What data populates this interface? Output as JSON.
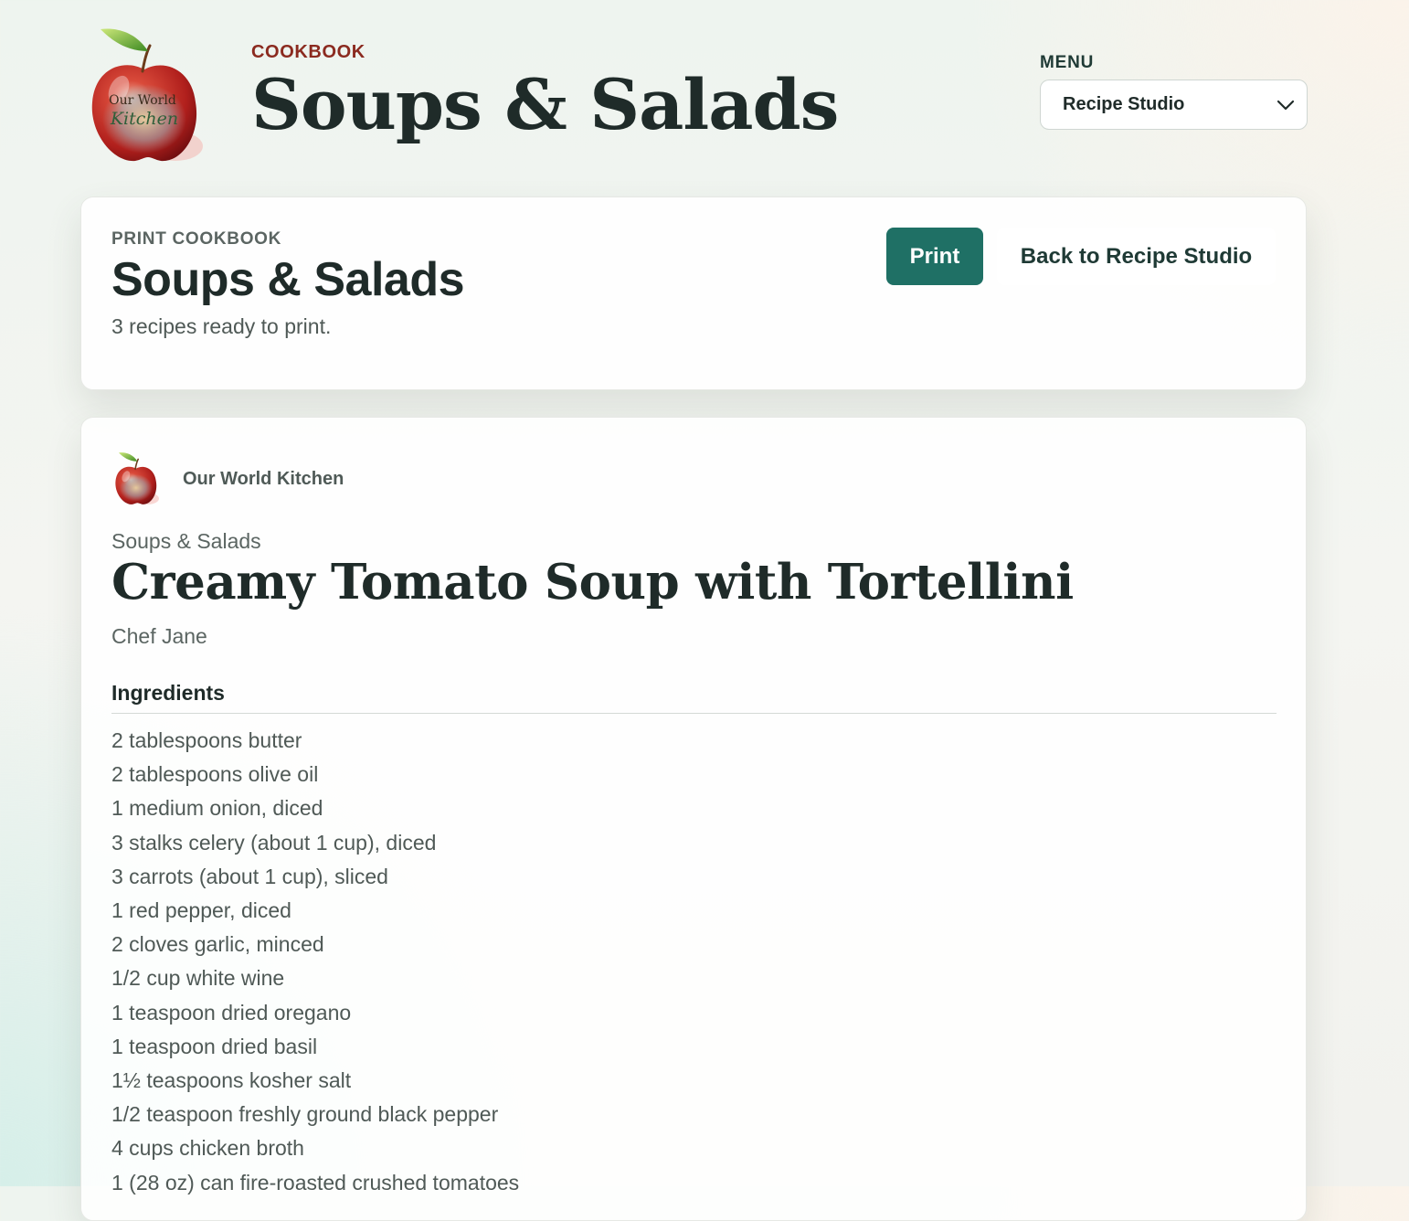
{
  "header": {
    "eyebrow": "COOKBOOK",
    "title": "Soups & Salads",
    "logo_text": [
      "Our World",
      "Kitchen"
    ],
    "logo_icon": "apple-logo-icon"
  },
  "menu": {
    "label": "MENU",
    "selected": "Recipe Studio",
    "icon": "chevron-down-icon"
  },
  "print_card": {
    "eyebrow": "PRINT COOKBOOK",
    "title": "Soups & Salads",
    "subtitle": "3 recipes ready to print.",
    "print_label": "Print",
    "back_label": "Back to Recipe Studio"
  },
  "recipe": {
    "brand": "Our World Kitchen",
    "category": "Soups & Salads",
    "title": "Creamy Tomato Soup with Tortellini",
    "chef": "Chef Jane",
    "ingredients_heading": "Ingredients",
    "ingredients": [
      "2 tablespoons butter",
      "2 tablespoons olive oil",
      "1 medium onion, diced",
      "3 stalks celery (about 1 cup), diced",
      "3 carrots (about 1 cup), sliced",
      "1 red pepper, diced",
      "2 cloves garlic, minced",
      "1/2 cup white wine",
      "1 teaspoon dried oregano",
      "1 teaspoon dried basil",
      "1½ teaspoons kosher salt",
      "1/2 teaspoon freshly ground black pepper",
      "4 cups chicken broth",
      "1 (28 oz) can fire-roasted crushed tomatoes"
    ]
  },
  "colors": {
    "accent": "#1f7065",
    "eyebrow": "#8b2a1f",
    "text_dark": "#1f2b29",
    "text_muted": "#4f5956"
  }
}
